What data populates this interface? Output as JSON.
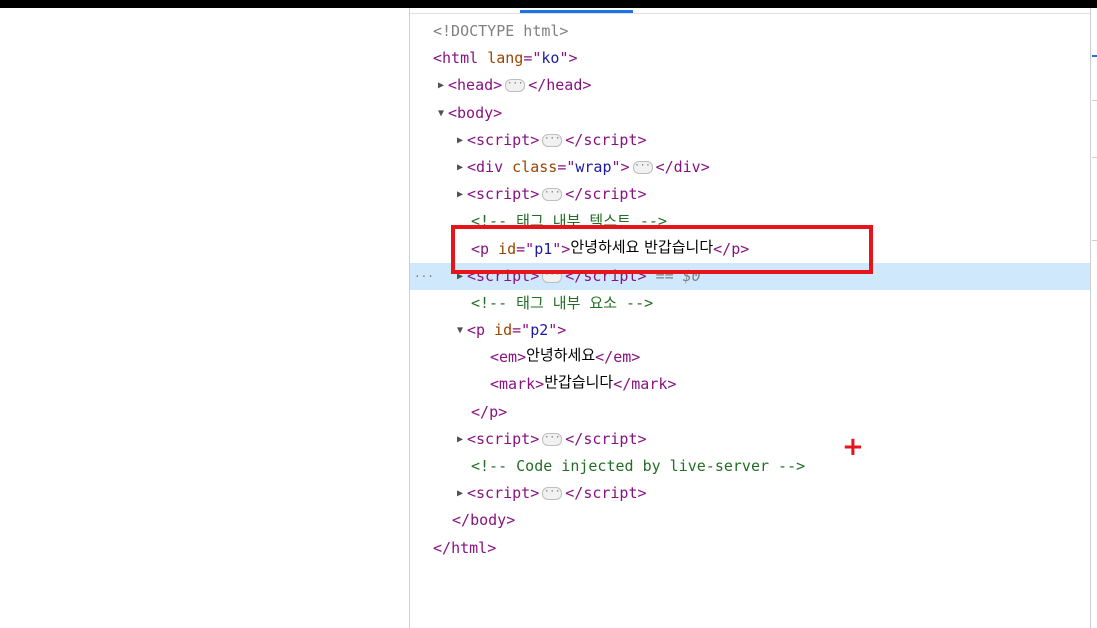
{
  "devtools": {
    "lines": [
      {
        "kind": "doctype",
        "text": "<!DOCTYPE html>"
      },
      {
        "kind": "open",
        "tag": "html",
        "attr": "lang",
        "val": "ko"
      },
      {
        "kind": "collapsed",
        "tag": "head"
      },
      {
        "kind": "expanded",
        "tag": "body"
      },
      {
        "kind": "collapsed",
        "tag": "script"
      },
      {
        "kind": "collapsed-attr",
        "tag": "div",
        "attr": "class",
        "val": "wrap"
      },
      {
        "kind": "collapsed",
        "tag": "script"
      },
      {
        "kind": "comment",
        "text": "<!-- 태그 내부 텍스트 -->"
      },
      {
        "kind": "inline",
        "tag": "p",
        "attr": "id",
        "val": "p1",
        "text": "안녕하세요 반갑습니다"
      },
      {
        "kind": "collapsed-selected",
        "tag": "script",
        "suffix": "== $0"
      },
      {
        "kind": "comment",
        "text": "<!-- 태그 내부 요소 -->"
      },
      {
        "kind": "expanded-attr",
        "tag": "p",
        "attr": "id",
        "val": "p2"
      },
      {
        "kind": "inline-plain",
        "tag": "em",
        "text": "안녕하세요"
      },
      {
        "kind": "inline-plain",
        "tag": "mark",
        "text": "반갑습니다"
      },
      {
        "kind": "close",
        "tag": "p"
      },
      {
        "kind": "collapsed",
        "tag": "script"
      },
      {
        "kind": "comment",
        "text": "<!-- Code injected by live-server -->"
      },
      {
        "kind": "collapsed",
        "tag": "script"
      },
      {
        "kind": "close",
        "tag": "body"
      },
      {
        "kind": "close",
        "tag": "html"
      }
    ],
    "ellipsis": "···",
    "selected_dots": "···"
  },
  "annotation": {
    "plus": "+"
  },
  "colors": {
    "highlight": "#e8141c",
    "selected_row": "#cfe8fc",
    "tag": "#881280",
    "attribute": "#994500",
    "value": "#1a1aa6",
    "comment": "#236e25"
  }
}
